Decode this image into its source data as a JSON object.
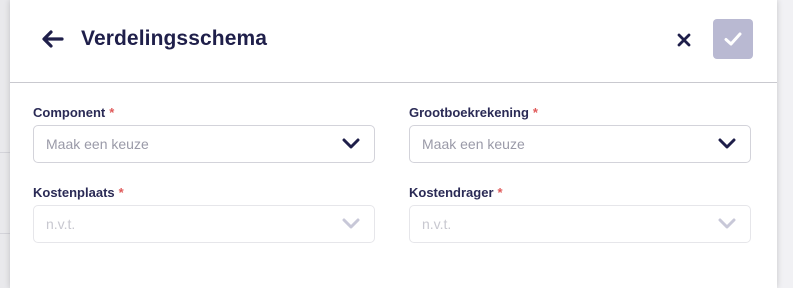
{
  "header": {
    "title": "Verdelingsschema",
    "back_icon": "arrow-left-icon",
    "close_icon": "close-icon",
    "confirm_icon": "check-icon"
  },
  "colors": {
    "title": "#1f1f4a",
    "required_marker": "#e05a5a",
    "confirm_button_bg": "#b9b9d2"
  },
  "fields": [
    {
      "label": "Component",
      "required_marker": "*",
      "value": "Maak een keuze",
      "enabled": true
    },
    {
      "label": "Grootboekrekening",
      "required_marker": "*",
      "value": "Maak een keuze",
      "enabled": true
    },
    {
      "label": "Kostenplaats",
      "required_marker": "*",
      "value": "n.v.t.",
      "enabled": false
    },
    {
      "label": "Kostendrager",
      "required_marker": "*",
      "value": "n.v.t.",
      "enabled": false
    }
  ]
}
